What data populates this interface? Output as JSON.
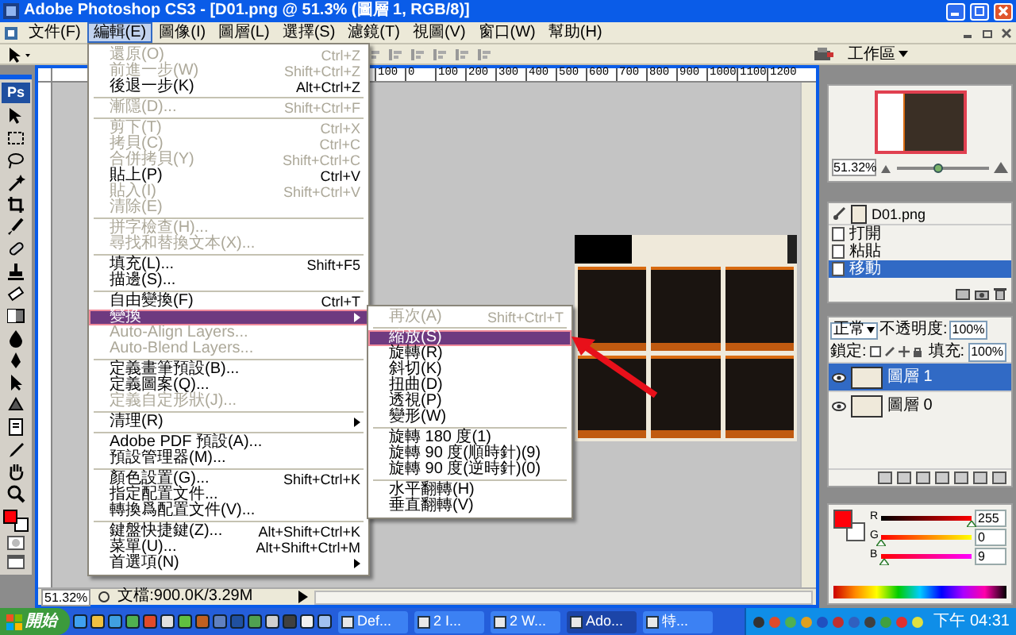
{
  "window": {
    "title": "Adobe Photoshop CS3 - [D01.png @ 51.3% (圖層 1, RGB/8)]"
  },
  "menubar": [
    {
      "label": "文件(F)",
      "selected": false
    },
    {
      "label": "編輯(E)",
      "selected": true
    },
    {
      "label": "圖像(I)",
      "selected": false
    },
    {
      "label": "圖層(L)",
      "selected": false
    },
    {
      "label": "選擇(S)",
      "selected": false
    },
    {
      "label": "濾鏡(T)",
      "selected": false
    },
    {
      "label": "視圖(V)",
      "selected": false
    },
    {
      "label": "窗口(W)",
      "selected": false
    },
    {
      "label": "幫助(H)",
      "selected": false
    }
  ],
  "edit_menu": [
    {
      "kind": "item",
      "label": "還原(O)",
      "shortcut": "Ctrl+Z",
      "disabled": true,
      "selected": false
    },
    {
      "kind": "item",
      "label": "前進一步(W)",
      "shortcut": "Shift+Ctrl+Z",
      "disabled": true,
      "selected": false
    },
    {
      "kind": "item",
      "label": "後退一步(K)",
      "shortcut": "Alt+Ctrl+Z",
      "disabled": false,
      "selected": false
    },
    {
      "kind": "separator"
    },
    {
      "kind": "item",
      "label": "漸隱(D)...",
      "shortcut": "Shift+Ctrl+F",
      "disabled": true,
      "selected": false
    },
    {
      "kind": "separator"
    },
    {
      "kind": "item",
      "label": "剪下(T)",
      "shortcut": "Ctrl+X",
      "disabled": true,
      "selected": false
    },
    {
      "kind": "item",
      "label": "拷貝(C)",
      "shortcut": "Ctrl+C",
      "disabled": true,
      "selected": false
    },
    {
      "kind": "item",
      "label": "合併拷貝(Y)",
      "shortcut": "Shift+Ctrl+C",
      "disabled": true,
      "selected": false
    },
    {
      "kind": "item",
      "label": "貼上(P)",
      "shortcut": "Ctrl+V",
      "disabled": false,
      "selected": false
    },
    {
      "kind": "item",
      "label": "貼入(I)",
      "shortcut": "Shift+Ctrl+V",
      "disabled": true,
      "selected": false
    },
    {
      "kind": "item",
      "label": "清除(E)",
      "disabled": true,
      "selected": false
    },
    {
      "kind": "separator"
    },
    {
      "kind": "item",
      "label": "拼字檢查(H)...",
      "disabled": true,
      "selected": false
    },
    {
      "kind": "item",
      "label": "尋找和替換文本(X)...",
      "disabled": true,
      "selected": false
    },
    {
      "kind": "separator"
    },
    {
      "kind": "item",
      "label": "填充(L)...",
      "shortcut": "Shift+F5",
      "disabled": false,
      "selected": false
    },
    {
      "kind": "item",
      "label": "描邊(S)...",
      "disabled": false,
      "selected": false
    },
    {
      "kind": "separator"
    },
    {
      "kind": "item",
      "label": "自由變換(F)",
      "shortcut": "Ctrl+T",
      "disabled": false,
      "selected": false
    },
    {
      "kind": "submenu",
      "label": "變換",
      "disabled": false,
      "selected": true
    },
    {
      "kind": "item",
      "label": "Auto-Align Layers...",
      "disabled": true,
      "selected": false
    },
    {
      "kind": "item",
      "label": "Auto-Blend Layers...",
      "disabled": true,
      "selected": false
    },
    {
      "kind": "separator"
    },
    {
      "kind": "item",
      "label": "定義畫筆預設(B)...",
      "disabled": false,
      "selected": false
    },
    {
      "kind": "item",
      "label": "定義圖案(Q)...",
      "disabled": false,
      "selected": false
    },
    {
      "kind": "item",
      "label": "定義自定形狀(J)...",
      "disabled": true,
      "selected": false
    },
    {
      "kind": "separator"
    },
    {
      "kind": "submenu",
      "label": "清理(R)",
      "disabled": false,
      "selected": false
    },
    {
      "kind": "separator"
    },
    {
      "kind": "item",
      "label": "Adobe PDF 預設(A)...",
      "disabled": false,
      "selected": false
    },
    {
      "kind": "item",
      "label": "預設管理器(M)...",
      "disabled": false,
      "selected": false
    },
    {
      "kind": "separator"
    },
    {
      "kind": "item",
      "label": "顏色設置(G)...",
      "shortcut": "Shift+Ctrl+K",
      "disabled": false,
      "selected": false
    },
    {
      "kind": "item",
      "label": "指定配置文件...",
      "disabled": false,
      "selected": false
    },
    {
      "kind": "item",
      "label": "轉換爲配置文件(V)...",
      "disabled": false,
      "selected": false
    },
    {
      "kind": "separator"
    },
    {
      "kind": "item",
      "label": "鍵盤快捷鍵(Z)...",
      "shortcut": "Alt+Shift+Ctrl+K",
      "disabled": false,
      "selected": false
    },
    {
      "kind": "item",
      "label": "菜單(U)...",
      "shortcut": "Alt+Shift+Ctrl+M",
      "disabled": false,
      "selected": false
    },
    {
      "kind": "submenu",
      "label": "首選項(N)",
      "disabled": false,
      "selected": false
    }
  ],
  "transform_submenu": [
    {
      "kind": "item",
      "label": "再次(A)",
      "shortcut": "Shift+Ctrl+T",
      "disabled": true,
      "selected": false
    },
    {
      "kind": "separator"
    },
    {
      "kind": "item",
      "label": "縮放(S)",
      "disabled": false,
      "selected": true
    },
    {
      "kind": "item",
      "label": "旋轉(R)",
      "disabled": false,
      "selected": false
    },
    {
      "kind": "item",
      "label": "斜切(K)",
      "disabled": false,
      "selected": false
    },
    {
      "kind": "item",
      "label": "扭曲(D)",
      "disabled": false,
      "selected": false
    },
    {
      "kind": "item",
      "label": "透視(P)",
      "disabled": false,
      "selected": false
    },
    {
      "kind": "item",
      "label": "變形(W)",
      "disabled": false,
      "selected": false
    },
    {
      "kind": "separator"
    },
    {
      "kind": "item",
      "label": "旋轉 180 度(1)",
      "disabled": false,
      "selected": false
    },
    {
      "kind": "item",
      "label": "旋轉 90 度(順時針)(9)",
      "disabled": false,
      "selected": false
    },
    {
      "kind": "item",
      "label": "旋轉 90 度(逆時針)(0)",
      "disabled": false,
      "selected": false
    },
    {
      "kind": "separator"
    },
    {
      "kind": "item",
      "label": "水平翻轉(H)",
      "disabled": false,
      "selected": false
    },
    {
      "kind": "item",
      "label": "垂直翻轉(V)",
      "disabled": false,
      "selected": false
    }
  ],
  "options_bar": {
    "workspace_button": "工作區"
  },
  "toolbox": {
    "logo": "Ps"
  },
  "ruler_labels": [
    "100",
    "0",
    "100",
    "200",
    "300",
    "400",
    "500",
    "600",
    "700",
    "800",
    "900",
    "1000",
    "1100",
    "1200"
  ],
  "document": {
    "zoom": "51.32%",
    "doc_info": "文檔:900.0K/3.29M"
  },
  "navigator": {
    "zoom": "51.32%",
    "level": 0.45
  },
  "history": {
    "snapshot": "D01.png",
    "items": [
      {
        "label": "打開",
        "selected": false
      },
      {
        "label": "粘貼",
        "selected": false
      },
      {
        "label": "移動",
        "selected": true
      }
    ]
  },
  "layers": {
    "blend_mode": "正常",
    "opacity_label": "不透明度:",
    "opacity": "100%",
    "lock_label": "鎖定:",
    "fill_label": "填充:",
    "fill": "100%",
    "layers": [
      {
        "name": "圖層 1",
        "selected": true,
        "visible": true
      },
      {
        "name": "圖層 0",
        "selected": false,
        "visible": true
      }
    ]
  },
  "color": {
    "channels": [
      {
        "label": "R",
        "value": "255",
        "level": 1
      },
      {
        "label": "G",
        "value": "0",
        "level": 0
      },
      {
        "label": "B",
        "value": "9",
        "level": 0.035
      }
    ]
  },
  "taskbar": {
    "start": "開始",
    "tasks": [
      {
        "label": "Def...",
        "selected": false
      },
      {
        "label": "2 I...",
        "selected": false
      },
      {
        "label": "2 W...",
        "selected": false
      },
      {
        "label": "Ado...",
        "selected": true
      },
      {
        "label": "特...",
        "selected": false
      }
    ],
    "clock": "下午 04:31"
  }
}
